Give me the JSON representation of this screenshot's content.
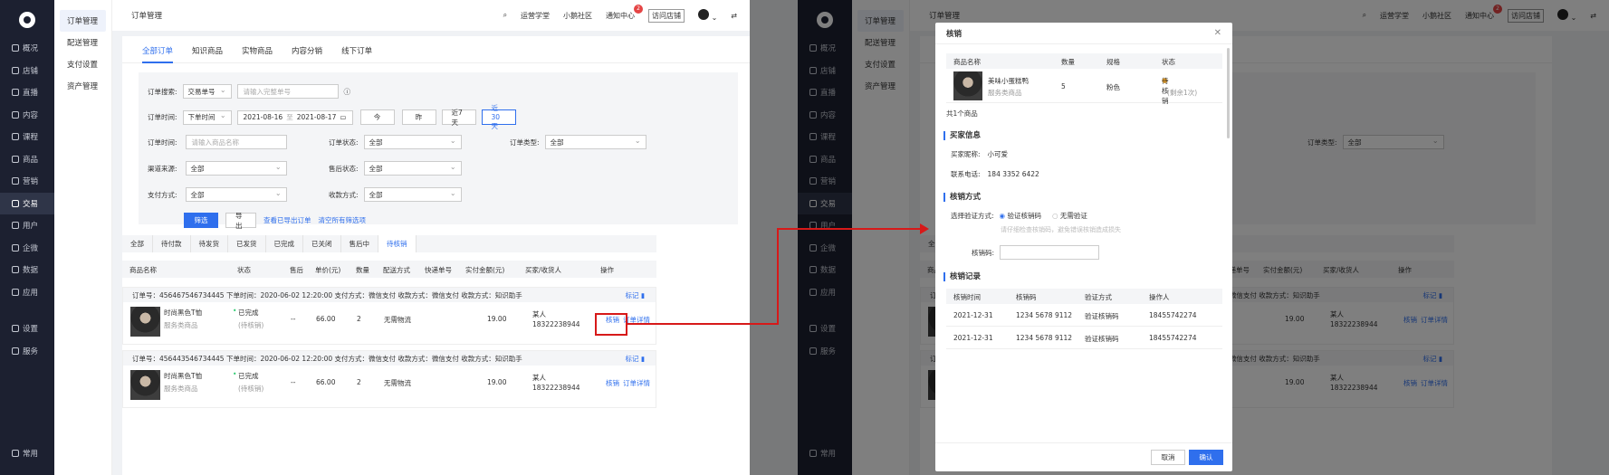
{
  "nav": {
    "items": [
      "概况",
      "店铺",
      "直播",
      "内容",
      "课程",
      "商品",
      "营销",
      "交易",
      "用户",
      "企微",
      "数据",
      "应用"
    ],
    "active": "交易",
    "extra": [
      "设置",
      "服务"
    ],
    "bottom": "常用"
  },
  "subnav": {
    "items": [
      "订单管理",
      "配送管理",
      "支付设置",
      "资产管理"
    ]
  },
  "header": {
    "title": "订单管理",
    "links": [
      "运营学堂",
      "小鹅社区",
      "通知中心"
    ],
    "notify_count": "2",
    "visit": "访问店铺"
  },
  "tabs": [
    "全部订单",
    "知识商品",
    "实物商品",
    "内容分销",
    "线下订单"
  ],
  "filter": {
    "search_label": "订单搜索:",
    "search_type": "交易单号",
    "search_placeholder": "请输入完整单号",
    "time_label": "订单时间:",
    "time_type": "下单时间",
    "date_from": "2021-08-16",
    "date_sep": "至",
    "date_to": "2021-08-17",
    "quick": [
      "今",
      "昨",
      "近7天",
      "近30天"
    ],
    "goods_label": "订单时间:",
    "goods_placeholder": "请输入商品名称",
    "status_label": "订单状态:",
    "status_value": "全部",
    "type_label": "订单类型:",
    "type_value": "全部",
    "channel_label": "渠道来源:",
    "channel_value": "全部",
    "after_label": "售后状态:",
    "after_value": "全部",
    "pay_label": "支付方式:",
    "pay_value": "全部",
    "receive_label": "收款方式:",
    "receive_value": "全部",
    "filter_btn": "筛选",
    "export_btn": "导出",
    "view_export": "查看已导出订单",
    "clear": "清空所有筛选项"
  },
  "status_tabs": [
    "全部",
    "待付款",
    "待发货",
    "已发货",
    "已完成",
    "已关闭",
    "售后中",
    "待核销"
  ],
  "columns": [
    "商品名称",
    "状态",
    "售后",
    "单价(元)",
    "数量",
    "配送方式",
    "快递单号",
    "实付金额(元)",
    "买家/收货人",
    "操作"
  ],
  "orders": [
    {
      "head": "订单号：456467546734445    下单时间：2020-06-02 12:20:00    支付方式：微信支付    收款方式：微信支付    收款方式：知识助手",
      "mark": "标记",
      "name": "时尚黑色T恤",
      "cat": "服务类商品",
      "status": "已完成",
      "sub": "(待核销)",
      "after": "--",
      "price": "66.00",
      "qty": "2",
      "ship": "无需物流",
      "paid": "19.00",
      "buyer": "某人",
      "phone": "18322238944",
      "ops": [
        "核销",
        "订单详情"
      ]
    },
    {
      "head": "订单号：456443546734445    下单时间：2020-06-02 12:20:00    支付方式：微信支付    收款方式：微信支付    收款方式：知识助手",
      "mark": "标记",
      "name": "时尚黑色T恤",
      "cat": "服务类商品",
      "status": "已完成",
      "sub": "(待核销)",
      "after": "--",
      "price": "66.00",
      "qty": "2",
      "ship": "无需物流",
      "paid": "19.00",
      "buyer": "某人",
      "phone": "18322238944",
      "ops": [
        "核销",
        "订单详情"
      ]
    }
  ],
  "modal": {
    "title": "核销",
    "cols": [
      "商品名称",
      "数量",
      "规格",
      "状态"
    ],
    "item": {
      "name": "美味小蛋糕鸭",
      "cat": "服务类商品",
      "qty": "5",
      "spec": "粉色",
      "status": "待核销",
      "remain": "(剩余1次)"
    },
    "total": "共1个商品",
    "buyer_title": "买家信息",
    "nick_label": "买家昵称:",
    "nick": "小可爱",
    "phone_label": "联系电话:",
    "phone": "184 3352 6422",
    "method_title": "核销方式",
    "choose_label": "选择验证方式:",
    "opt1": "验证核销码",
    "opt2": "无需验证",
    "hint": "请仔细检查核销码，避免错误核销造成损失",
    "code_label": "核销码:",
    "record_title": "核销记录",
    "rcols": [
      "核销时间",
      "核销码",
      "验证方式",
      "操作人"
    ],
    "records": [
      {
        "time": "2021-12-31",
        "code": "1234 5678 9112",
        "way": "验证核销码",
        "op": "18455742274"
      },
      {
        "time": "2021-12-31",
        "code": "1234 5678 9112",
        "way": "验证核销码",
        "op": "18455742274"
      }
    ],
    "cancel": "取消",
    "confirm": "确认"
  },
  "colors": {
    "primary": "#2f6fed",
    "sidebar": "#1c2030",
    "highlight": "#d71919"
  }
}
